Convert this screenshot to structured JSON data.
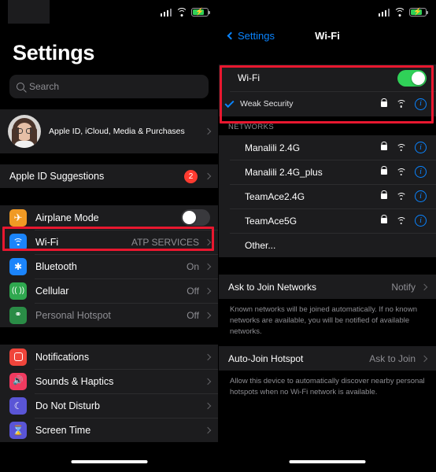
{
  "status_bar": {
    "signal_icon": "cellular-signal-icon",
    "wifi_icon": "wifi-icon",
    "battery_icon": "battery-charging-icon"
  },
  "left_pane": {
    "title": "Settings",
    "search": {
      "placeholder": "Search",
      "value": "",
      "icon": "search-icon"
    },
    "profile": {
      "label": "Apple ID, iCloud, Media & Purchases",
      "avatar": "memoji-avatar"
    },
    "suggestions": {
      "label": "Apple ID Suggestions",
      "badge": "2"
    },
    "connectivity": [
      {
        "label": "Airplane Mode",
        "icon": "airplane-icon",
        "icon_color": "#f09a24",
        "control": "toggle",
        "toggle_on": false
      },
      {
        "label": "Wi-Fi",
        "icon": "wifi-icon",
        "icon_color": "#1b84fb",
        "value": "ATP SERVICES",
        "control": "chevron",
        "highlighted": true
      },
      {
        "label": "Bluetooth",
        "icon": "bluetooth-icon",
        "icon_color": "#1b84fb",
        "value": "On",
        "control": "chevron"
      },
      {
        "label": "Cellular",
        "icon": "cellular-icon",
        "icon_color": "#2fa84f",
        "value": "Off",
        "control": "chevron"
      },
      {
        "label": "Personal Hotspot",
        "icon": "hotspot-icon",
        "icon_color": "#2a8c46",
        "value": "Off",
        "control": "chevron",
        "dimmed": true
      }
    ],
    "alerts": [
      {
        "label": "Notifications",
        "icon": "notifications-icon",
        "icon_color": "#f0453b"
      },
      {
        "label": "Sounds & Haptics",
        "icon": "sounds-icon",
        "icon_color": "#f03a5f"
      },
      {
        "label": "Do Not Disturb",
        "icon": "moon-icon",
        "icon_color": "#5a55d6"
      },
      {
        "label": "Screen Time",
        "icon": "hourglass-icon",
        "icon_color": "#5a55d6"
      }
    ]
  },
  "right_pane": {
    "nav": {
      "back_label": "Settings",
      "back_icon": "chevron-left-icon",
      "title": "Wi-Fi"
    },
    "wifi_toggle": {
      "label": "Wi-Fi",
      "on": true
    },
    "connected_network": {
      "name": "Weak Security",
      "checked": true,
      "check_icon": "checkmark-icon",
      "lock_icon": "lock-icon",
      "signal_icon": "wifi-icon",
      "info_icon": "info-icon"
    },
    "networks_header": "NETWORKS",
    "networks": [
      {
        "name": "Manalili 2.4G",
        "locked": true
      },
      {
        "name": "Manalili 2.4G_plus",
        "locked": true
      },
      {
        "name": "TeamAce2.4G",
        "locked": true
      },
      {
        "name": "TeamAce5G",
        "locked": true
      }
    ],
    "other_label": "Other...",
    "ask_to_join": {
      "label": "Ask to Join Networks",
      "value": "Notify"
    },
    "ask_to_join_note": "Known networks will be joined automatically. If no known networks are available, you will be notified of available networks.",
    "auto_join_hotspot": {
      "label": "Auto-Join Hotspot",
      "value": "Ask to Join"
    },
    "auto_join_note": "Allow this device to automatically discover nearby personal hotspots when no Wi-Fi network is available."
  },
  "annotations": {
    "highlight_color": "#e8172f",
    "highlight_count": 2
  }
}
